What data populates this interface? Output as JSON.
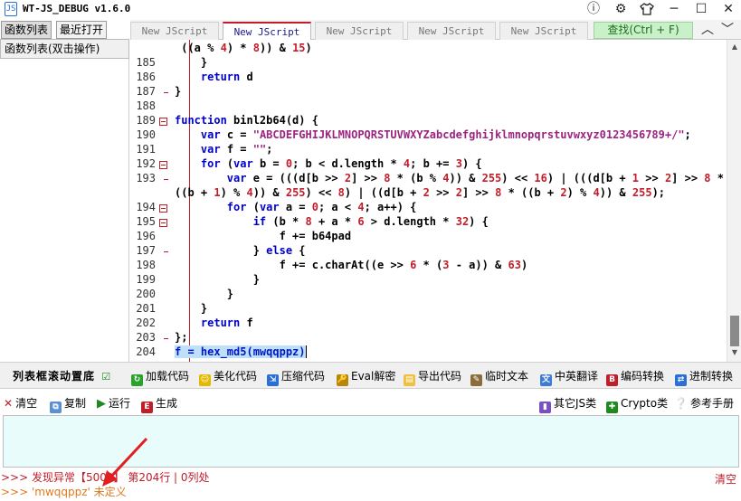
{
  "window": {
    "title": "WT-JS_DEBUG v1.6.0",
    "icon_text": "JS"
  },
  "left_panel": {
    "tabs": [
      {
        "label": "函数列表",
        "active": true
      },
      {
        "label": "最近打开",
        "active": false
      }
    ],
    "header": "函数列表(双击操作)"
  },
  "editor_tabs": [
    {
      "label": "New JScript",
      "active": false
    },
    {
      "label": "New JScript",
      "active": true
    },
    {
      "label": "New JScript",
      "active": false
    },
    {
      "label": "New JScript",
      "active": false
    },
    {
      "label": "New JScript",
      "active": false
    }
  ],
  "find_button": "查找(Ctrl + F)",
  "code": {
    "lines": [
      {
        "num": "",
        "text": " ((a % 4) * 8)) & 15)"
      },
      {
        "num": "185",
        "text": "    }"
      },
      {
        "num": "186",
        "text": "    return d"
      },
      {
        "num": "187",
        "text": "}"
      },
      {
        "num": "188",
        "text": ""
      },
      {
        "num": "189",
        "text": "function binl2b64(d) {"
      },
      {
        "num": "190",
        "text": "    var c = \"ABCDEFGHIJKLMNOPQRSTUVWXYZabcdefghijklmnopqrstuvwxyz0123456789+/\";"
      },
      {
        "num": "191",
        "text": "    var f = \"\";"
      },
      {
        "num": "192",
        "text": "    for (var b = 0; b < d.length * 4; b += 3) {"
      },
      {
        "num": "193",
        "text": "        var e = (((d[b >> 2] >> 8 * (b % 4)) & 255) << 16) | (((d[b + 1 >> 2] >> 8 *"
      },
      {
        "num": "",
        "text": "((b + 1) % 4)) & 255) << 8) | ((d[b + 2 >> 2] >> 8 * ((b + 2) % 4)) & 255);"
      },
      {
        "num": "194",
        "text": "        for (var a = 0; a < 4; a++) {"
      },
      {
        "num": "195",
        "text": "            if (b * 8 + a * 6 > d.length * 32) {"
      },
      {
        "num": "196",
        "text": "                f += b64pad"
      },
      {
        "num": "197",
        "text": "            } else {"
      },
      {
        "num": "198",
        "text": "                f += c.charAt((e >> 6 * (3 - a)) & 63)"
      },
      {
        "num": "199",
        "text": "            }"
      },
      {
        "num": "200",
        "text": "        }"
      },
      {
        "num": "201",
        "text": "    }"
      },
      {
        "num": "202",
        "text": "    return f"
      },
      {
        "num": "203",
        "text": "};"
      },
      {
        "num": "204",
        "text": "f = hex_md5(mwqqppz)"
      }
    ],
    "highlighted_line": "204"
  },
  "toolbar1": {
    "scroll_bottom_label": "列表框滚动置底",
    "scroll_bottom_checked": true,
    "buttons": [
      {
        "label": "加载代码",
        "icon": "load-icon"
      },
      {
        "label": "美化代码",
        "icon": "beautify-icon"
      },
      {
        "label": "压缩代码",
        "icon": "compress-icon"
      },
      {
        "label": "Eval解密",
        "icon": "eval-icon"
      },
      {
        "label": "导出代码",
        "icon": "export-icon"
      },
      {
        "label": "临时文本",
        "icon": "temp-text-icon"
      },
      {
        "label": "中英翻译",
        "icon": "translate-icon"
      },
      {
        "label": "编码转换",
        "icon": "encode-icon"
      },
      {
        "label": "进制转换",
        "icon": "radix-icon"
      }
    ]
  },
  "toolbar2": {
    "left": [
      {
        "label": "清空",
        "icon": "clear-icon"
      },
      {
        "label": "复制",
        "icon": "copy-icon"
      },
      {
        "label": "运行",
        "icon": "run-icon"
      },
      {
        "label": "生成",
        "icon": "generate-icon"
      }
    ],
    "right": [
      {
        "label": "其它JS类",
        "icon": "other-js-icon"
      },
      {
        "label": "Crypto类",
        "icon": "crypto-icon"
      },
      {
        "label": "参考手册",
        "icon": "manual-icon"
      }
    ]
  },
  "status": {
    "line1": ">>> 发现异常【5009】 第204行 | 0列处",
    "line2": ">>> 'mwqqppz' 未定义",
    "clear_label": "清空"
  },
  "colors": {
    "error_red": "#c21d2a",
    "warning_orange": "#e07a1a",
    "find_green": "#c9f0c9",
    "console_bg": "#e8fcfc",
    "highlight": "#bfe0fb"
  }
}
